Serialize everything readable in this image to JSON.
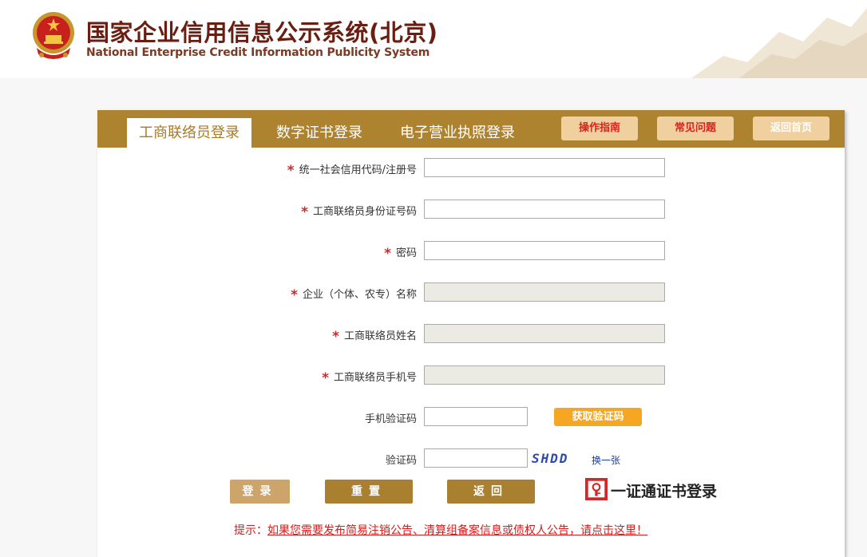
{
  "header": {
    "title_cn": "国家企业信用信息公示系统(北京)",
    "title_en": "National Enterprise Credit Information Publicity System"
  },
  "tabs": [
    {
      "label": "工商联络员登录",
      "active": true
    },
    {
      "label": "数字证书登录",
      "active": false
    },
    {
      "label": "电子营业执照登录",
      "active": false
    }
  ],
  "top_buttons": {
    "guide": "操作指南",
    "faq": "常见问题",
    "home": "返回首页"
  },
  "form": {
    "required_mark": "*",
    "fields": [
      {
        "label": "统一社会信用代码/注册号",
        "required": true,
        "readonly": false,
        "value": ""
      },
      {
        "label": "工商联络员身份证号码",
        "required": true,
        "readonly": false,
        "value": ""
      },
      {
        "label": "密码",
        "required": true,
        "readonly": false,
        "value": ""
      },
      {
        "label": "企业（个体、农专）名称",
        "required": true,
        "readonly": true,
        "value": ""
      },
      {
        "label": "工商联络员姓名",
        "required": true,
        "readonly": true,
        "value": ""
      },
      {
        "label": "工商联络员手机号",
        "required": true,
        "readonly": true,
        "value": ""
      }
    ],
    "sms_label": "手机验证码",
    "sms_button": "获取验证码",
    "captcha_label": "验证码",
    "captcha_text": "SHDD",
    "captcha_refresh": "换一张"
  },
  "actions": {
    "login": "登录",
    "reset": "重置",
    "back": "返回",
    "cert_login": "一证通证书登录"
  },
  "notice": {
    "prefix": "提示：",
    "link": "如果您需要发布简易注销公告、清算组备案信息或债权人公告，请点击这里！"
  },
  "colors": {
    "bar": "#ad8330",
    "accent_orange": "#f5a623",
    "button_light": "#f1d0a0",
    "required_red": "#d32828",
    "title_red": "#6a1e12"
  }
}
